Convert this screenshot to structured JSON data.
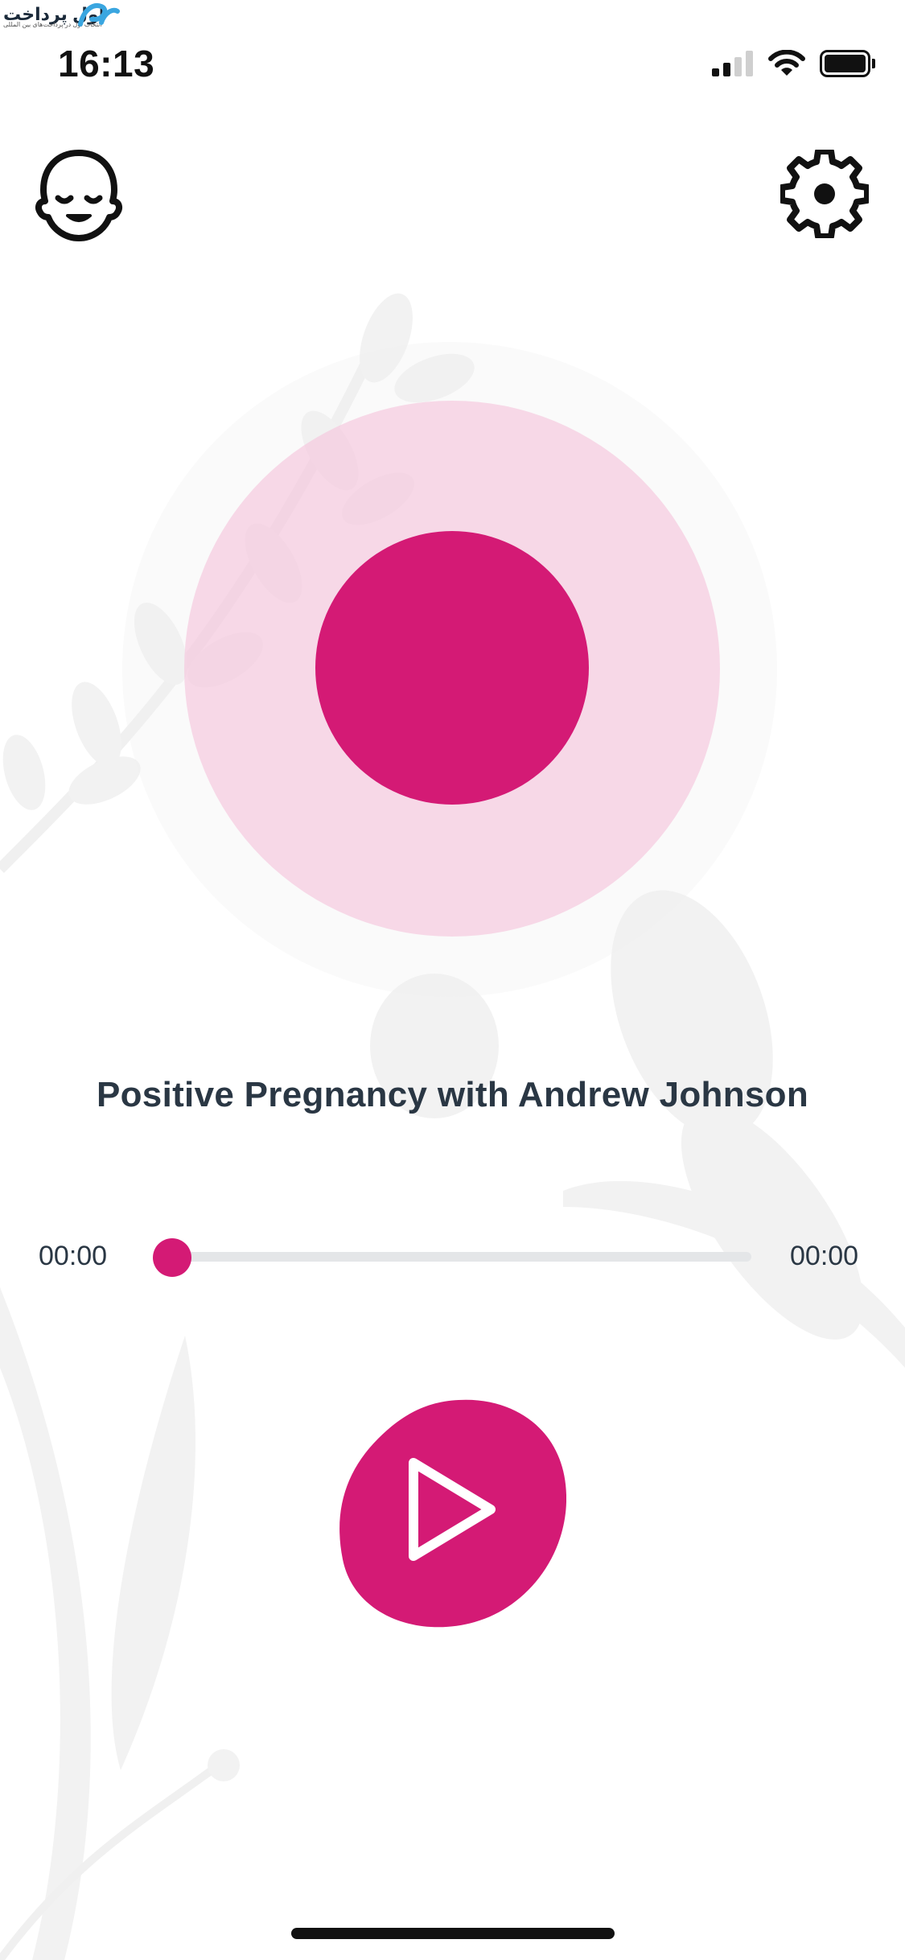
{
  "watermark": {
    "text": "اول پرداخت",
    "subtitle": "انتخاب اول در پرداخت‌های بین المللی"
  },
  "status_bar": {
    "time": "16:13",
    "signal_icon": "signal-bars-icon",
    "wifi_icon": "wifi-icon",
    "battery_icon": "battery-icon"
  },
  "header": {
    "left_icon": "meditating-face-icon",
    "right_icon": "gear-icon"
  },
  "player": {
    "title": "Positive Pregnancy with Andrew Johnson",
    "elapsed": "00:00",
    "duration": "00:00",
    "progress": 0,
    "play_icon": "play-icon"
  },
  "colors": {
    "accent": "#d41a75",
    "accent_soft": "#f5c4db",
    "text": "#2a3744",
    "track": "#e4e6e8"
  }
}
